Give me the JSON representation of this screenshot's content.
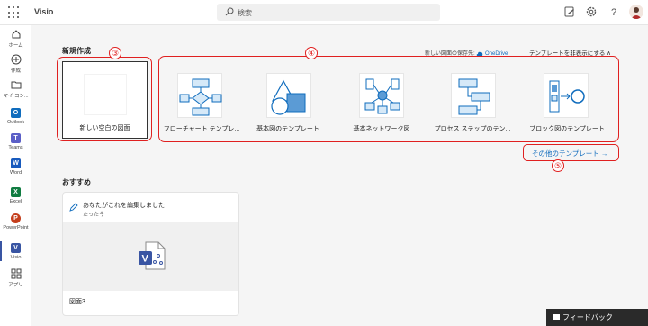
{
  "app": {
    "title": "Visio"
  },
  "search": {
    "placeholder": "検索"
  },
  "rail": {
    "items": [
      {
        "label": "ホーム",
        "icon": "home-icon"
      },
      {
        "label": "作成",
        "icon": "create-icon"
      },
      {
        "label": "マイ コン...",
        "icon": "folder-icon"
      },
      {
        "label": "Outlook",
        "icon": "outlook-icon",
        "color": "#0f6cbd",
        "letter": "O"
      },
      {
        "label": "Teams",
        "icon": "teams-icon",
        "color": "#5b5fc7",
        "letter": "T"
      },
      {
        "label": "Word",
        "icon": "word-icon",
        "color": "#185abd",
        "letter": "W"
      },
      {
        "label": "Excel",
        "icon": "excel-icon",
        "color": "#107c41",
        "letter": "X"
      },
      {
        "label": "PowerPoint",
        "icon": "powerpoint-icon",
        "color": "#c43e1c",
        "letter": "P"
      },
      {
        "label": "Visio",
        "icon": "visio-icon",
        "color": "#3955a3",
        "letter": "V"
      },
      {
        "label": "アプリ",
        "icon": "apps-icon"
      }
    ]
  },
  "new_section": {
    "title": "新規作成",
    "save_location_label": "新しい図面の保存先:",
    "save_location_value": "OneDrive",
    "hide_templates": "テンプレートを非表示にする ∧",
    "blank": "新しい空白の図面",
    "templates": [
      {
        "label": "フローチャート テンプレ...",
        "icon": "flowchart-icon"
      },
      {
        "label": "基本図のテンプレート",
        "icon": "basic-shapes-icon"
      },
      {
        "label": "基本ネットワーク図",
        "icon": "network-icon"
      },
      {
        "label": "プロセス ステップのテン...",
        "icon": "process-steps-icon"
      },
      {
        "label": "ブロック図のテンプレート",
        "icon": "block-diagram-icon"
      }
    ],
    "more_templates": "その他のテンプレート →"
  },
  "annotations": {
    "n3": "③",
    "n4": "④",
    "n5": "⑤"
  },
  "recommended": {
    "title": "おすすめ",
    "card": {
      "activity": "あなたがこれを編集しました",
      "time": "たった今",
      "file_name": "図面3"
    }
  },
  "feedback": {
    "label": "フィードバック"
  },
  "colors": {
    "accent": "#0f6cbd",
    "visio": "#3955a3",
    "annotation": "#e02020"
  }
}
